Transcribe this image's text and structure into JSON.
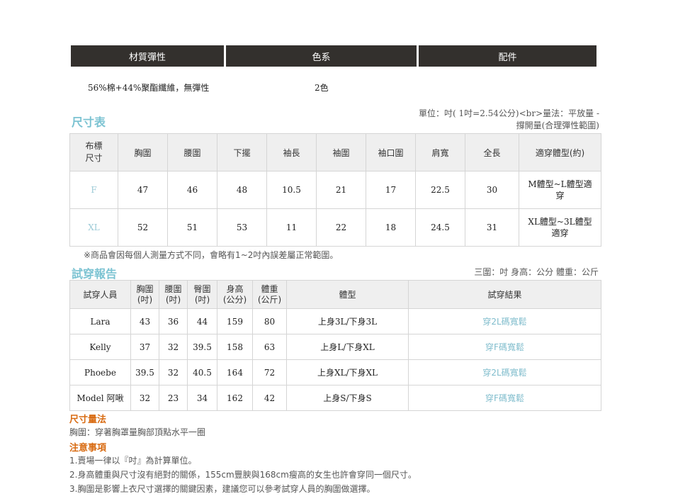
{
  "material": {
    "headers": [
      "材質彈性",
      "色系",
      "配件"
    ],
    "fabric": "56%棉+44%聚酯纖維，無彈性",
    "colors": "2色"
  },
  "size_chart": {
    "title": "尺寸表",
    "unit_note_line1": "單位：吋( 1吋=2.54公分)<br>量法：平放量 -",
    "unit_note_line2": "撐開量(合理彈性範圍)",
    "headers": [
      "布標\n尺寸",
      "胸圍",
      "腰圍",
      "下擺",
      "袖長",
      "袖圍",
      "袖口圍",
      "肩寬",
      "全長",
      "適穿體型(約)"
    ],
    "rows": [
      [
        "F",
        "47",
        "46",
        "48",
        "10.5",
        "21",
        "17",
        "22.5",
        "30",
        "M體型~L體型適穿"
      ],
      [
        "XL",
        "52",
        "51",
        "53",
        "11",
        "22",
        "18",
        "24.5",
        "31",
        "XL體型~3L體型適穿"
      ]
    ],
    "footnote": "※商品會因每個人測量方式不同，會略有1~2吋內誤差屬正常範圍。"
  },
  "fitting": {
    "title": "試穿報告",
    "unit_note": "三圍：吋 身高：公分 體重：公斤",
    "headers": [
      "試穿人員",
      "胸圍\n(吋)",
      "腰圍\n(吋)",
      "臀圍\n(吋)",
      "身高\n(公分)",
      "體重\n(公斤)",
      "體型",
      "試穿結果"
    ],
    "rows": [
      [
        "Lara",
        "43",
        "36",
        "44",
        "159",
        "80",
        "上身3L/下身3L",
        "穿2L碼寬鬆"
      ],
      [
        "Kelly",
        "37",
        "32",
        "39.5",
        "158",
        "63",
        "上身L/下身XL",
        "穿F碼寬鬆"
      ],
      [
        "Phoebe",
        "39.5",
        "32",
        "40.5",
        "164",
        "72",
        "上身XL/下身XL",
        "穿2L碼寬鬆"
      ],
      [
        "Model 阿啾",
        "32",
        "23",
        "34",
        "162",
        "42",
        "上身S/下身S",
        "穿F碼寬鬆"
      ]
    ]
  },
  "measure": {
    "title": "尺寸量法",
    "text": "胸圍：穿著胸罩量胸部頂點水平一圈"
  },
  "notice": {
    "title": "注意事項",
    "items": [
      "1.賣場一律以『吋』為計算單位。",
      "2.身高體重與尺寸沒有絕對的關係，155cm豐腴與168cm瘦高的女生也許會穿同一個尺寸。",
      "3.胸圍是影響上衣尺寸選擇的關鍵因素，建議您可以參考試穿人員的胸圍做選擇。"
    ]
  }
}
